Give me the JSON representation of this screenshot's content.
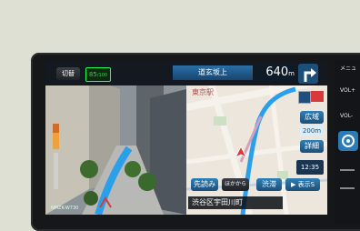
{
  "topbar": {
    "back_label": "切替",
    "speed_display": "85",
    "speed_unit": "/100",
    "next_intersection": "道玄坂上",
    "distance": "640",
    "distance_unit": "m"
  },
  "map": {
    "place_label": "東京駅",
    "scale_value": "200m",
    "clock": "12:35",
    "address": "渋谷区宇田川町"
  },
  "buttons": {
    "wide": "広域",
    "detail": "詳細",
    "preview": "先読み",
    "traffic": "渋滞",
    "display": "▶ 表示S",
    "vics": "ほかから"
  },
  "device": {
    "model": "NMZK-W730"
  },
  "side_panel": {
    "menu": "メニュ",
    "vol_up": "VOL+",
    "vol_down": "VOL-"
  },
  "colors": {
    "route_blue": "#2aa0ea",
    "accent_red": "#d83a3a",
    "speed_green": "#3ad04a"
  },
  "icons": {
    "turn_arrow": "right-turn-arrow-icon",
    "car_position": "car-position-icon"
  }
}
